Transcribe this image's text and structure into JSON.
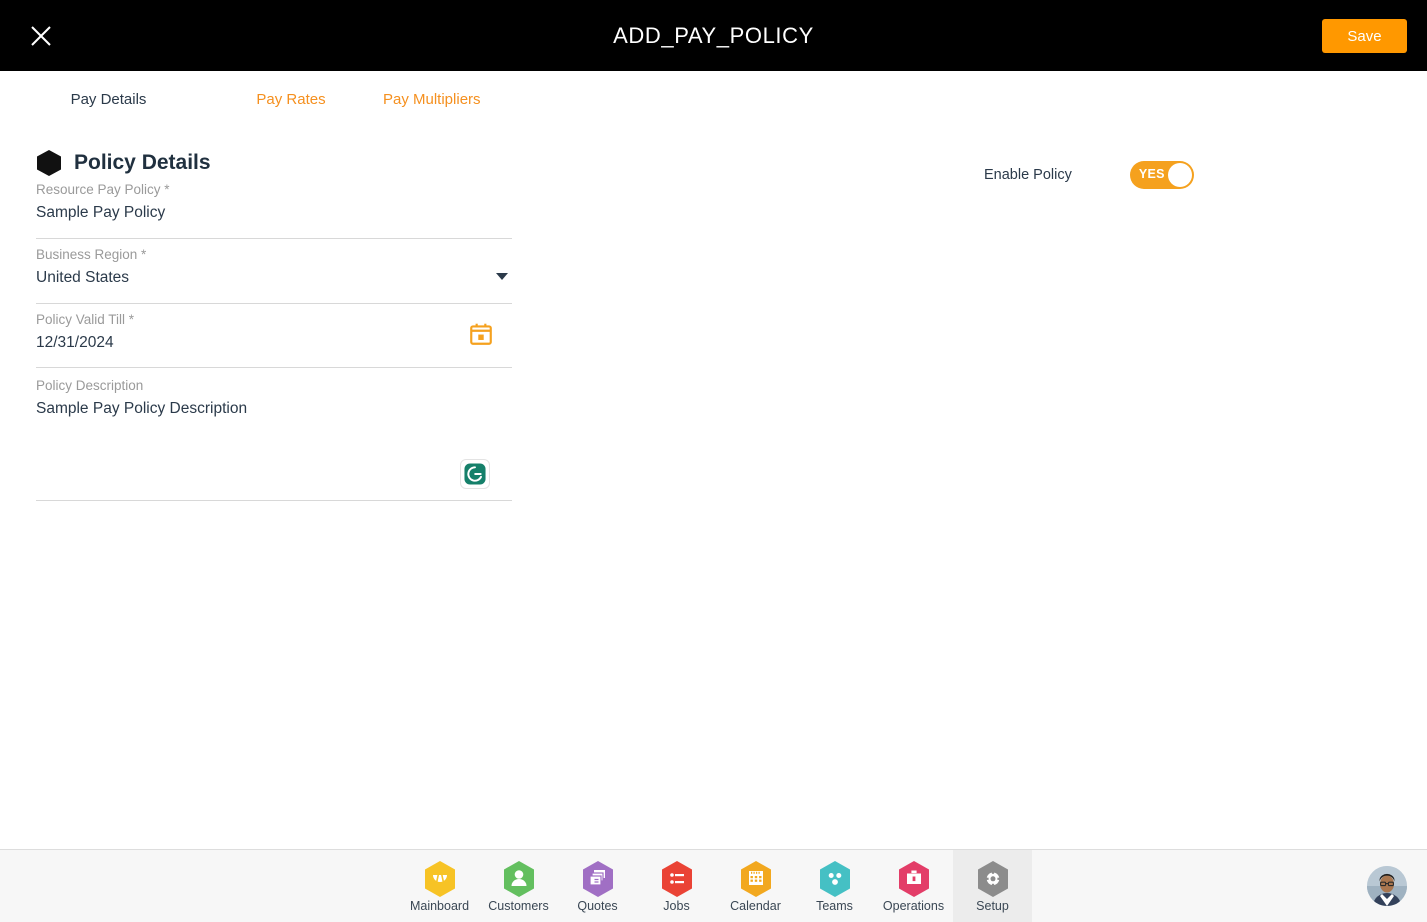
{
  "header": {
    "title": "ADD_PAY_POLICY",
    "close_icon": "close-icon",
    "save_label": "Save",
    "background": "#000000",
    "save_color": "#ff9800"
  },
  "tabs": [
    {
      "label": "Pay Details",
      "active": true,
      "color": "#2b3a4a"
    },
    {
      "label": "Pay Rates",
      "active": false,
      "color": "#f5901f"
    },
    {
      "label": "Pay Multipliers",
      "active": false,
      "color": "#f5901f"
    }
  ],
  "section": {
    "title": "Policy Details",
    "bullet_icon": "hexagon-bullet-icon"
  },
  "fields": {
    "resource_pay_policy": {
      "label": "Resource Pay Policy *",
      "value": "Sample Pay Policy",
      "placeholder": "Resource Pay Policy"
    },
    "business_region": {
      "label": "Business Region *",
      "value": "United States",
      "placeholder": "Business Region",
      "dropdown_icon": "chevron-down-icon"
    },
    "policy_valid_till": {
      "label": "Policy Valid Till *",
      "value": "12/31/2024",
      "placeholder": "MM/DD/YYYY",
      "calendar_icon": "calendar-icon",
      "calendar_color": "#f5a11e"
    },
    "policy_description": {
      "label": "Policy Description",
      "value": "Sample Pay Policy Description",
      "placeholder": "Policy Description",
      "assistant_icon": "grammarly-icon",
      "assistant_color": "#15806a"
    }
  },
  "enable_policy": {
    "label": "Enable Policy",
    "toggle_value": "YES",
    "toggle_on": true,
    "toggle_color": "#f5a11e"
  },
  "bottom_nav": {
    "items": [
      {
        "label": "Mainboard",
        "icon": "mainboard-icon",
        "color": "#f7c325",
        "active": false
      },
      {
        "label": "Customers",
        "icon": "customers-icon",
        "color": "#63bf5f",
        "active": false
      },
      {
        "label": "Quotes",
        "icon": "quotes-icon",
        "color": "#a06fc4",
        "active": false
      },
      {
        "label": "Jobs",
        "icon": "jobs-icon",
        "color": "#ea4335",
        "active": false
      },
      {
        "label": "Calendar",
        "icon": "calendar-icon",
        "color": "#f2a81f",
        "active": false
      },
      {
        "label": "Teams",
        "icon": "teams-icon",
        "color": "#45c0c4",
        "active": false
      },
      {
        "label": "Operations",
        "icon": "operations-icon",
        "color": "#e33d68",
        "active": false
      },
      {
        "label": "Setup",
        "icon": "setup-gear-icon",
        "color": "#8c8c8c",
        "active": true
      }
    ],
    "avatar_icon": "user-avatar"
  }
}
